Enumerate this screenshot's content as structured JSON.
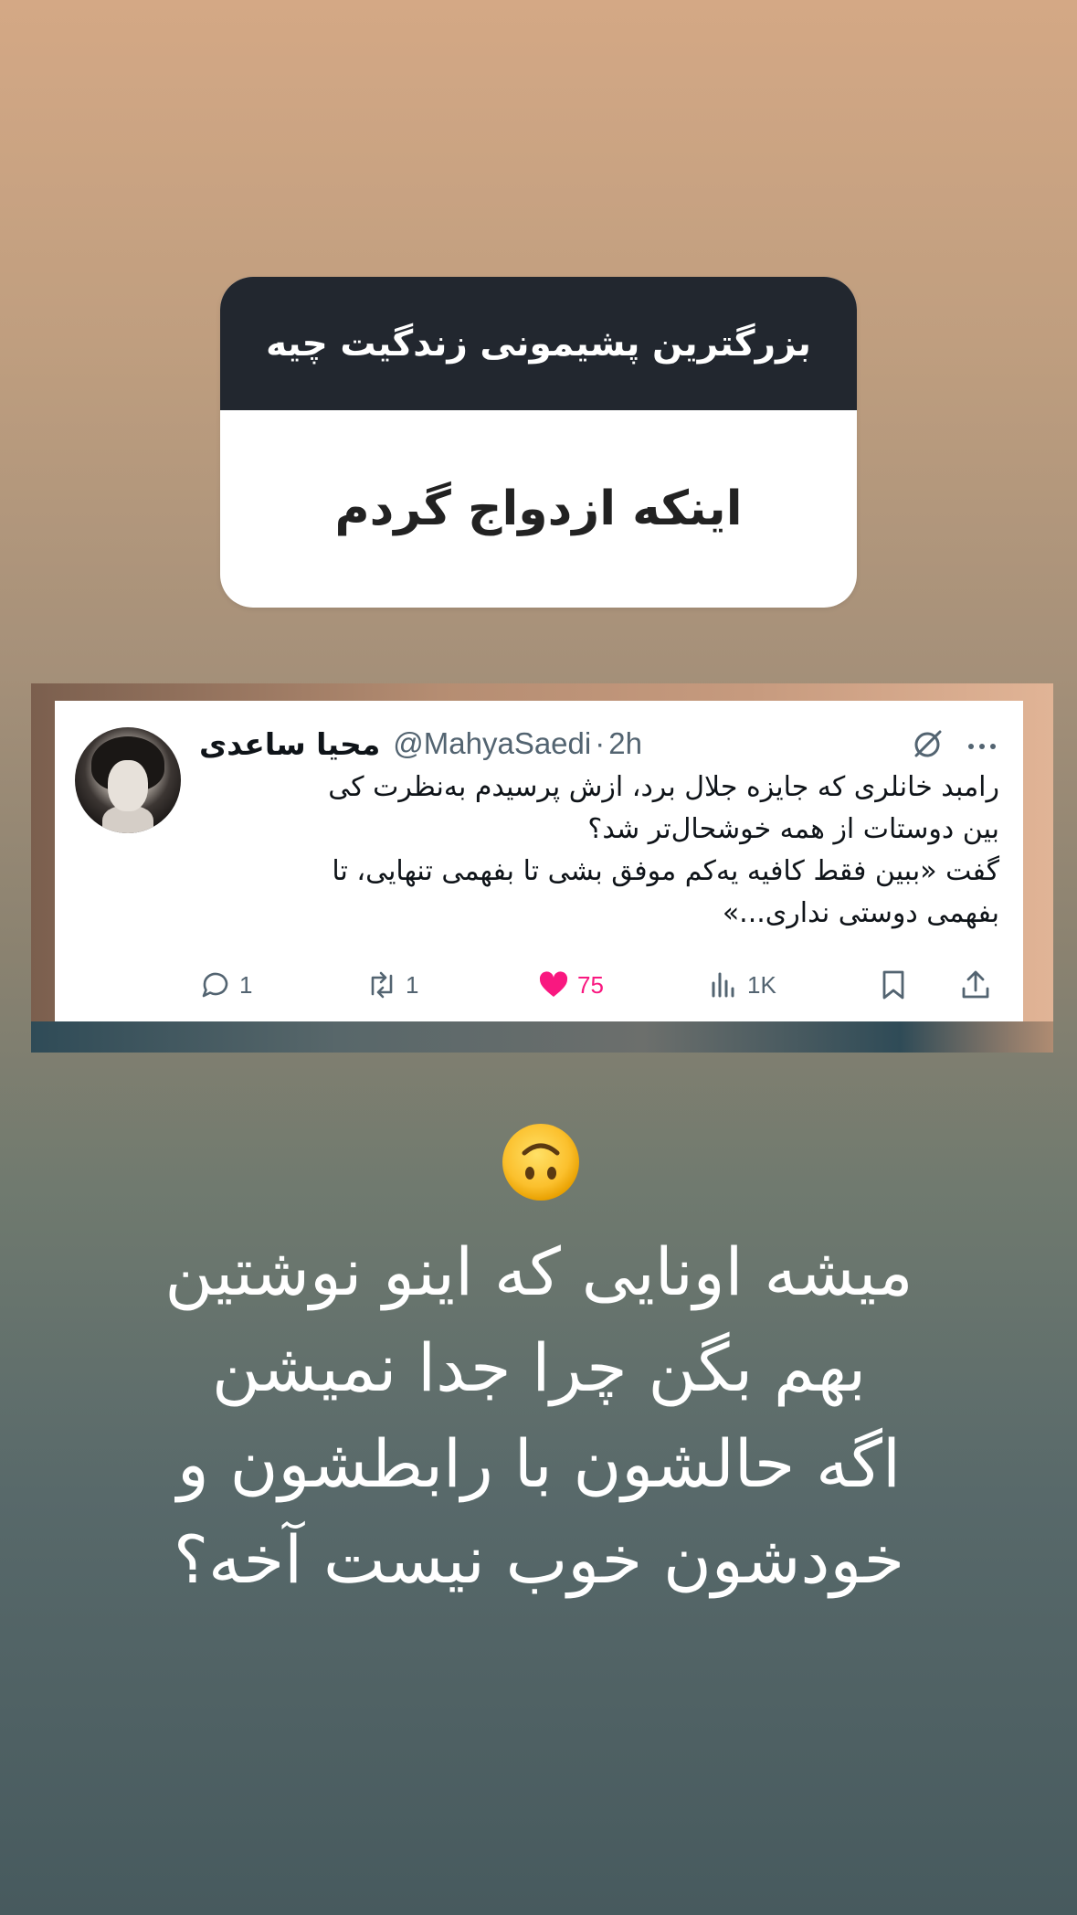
{
  "question_sticker": {
    "question": "بزرگترین پشیمونی زندگیت چیه",
    "answer": "اینکه ازدواج گردم"
  },
  "tweet": {
    "display_name": "محیا ساعدی",
    "handle": "@MahyaSaedi",
    "separator": "·",
    "time": "2h",
    "lines": [
      "رامبد خانلری که جایزه جلال برد، ازش پرسیدم به‌نظرت کی",
      "بین دوستات از همه خوشحال‌تر شد؟",
      "گفت «ببین فقط کافیه یه‌کم موفق بشی تا بفهمی تنهایی، تا",
      "بفهمی دوستی نداری...»"
    ],
    "stats": {
      "replies": "1",
      "retweets": "1",
      "likes": "75",
      "views": "1K"
    },
    "icons": {
      "grok": "grok-icon",
      "more": "more-icon",
      "reply": "reply-icon",
      "retweet": "retweet-icon",
      "like": "heart-icon",
      "views": "views-icon",
      "bookmark": "bookmark-icon",
      "share": "share-icon"
    },
    "colors": {
      "like": "#f91880",
      "muted": "#536471",
      "text": "#0f1419"
    }
  },
  "emoji": "upside-down-face",
  "caption": {
    "lines": [
      "میشه اونایی که اینو نوشتین",
      "بهم بگن چرا جدا نمیشن",
      "اگه حالشون با رابطشون و",
      "خودشون خوب نیست آخه؟"
    ]
  }
}
